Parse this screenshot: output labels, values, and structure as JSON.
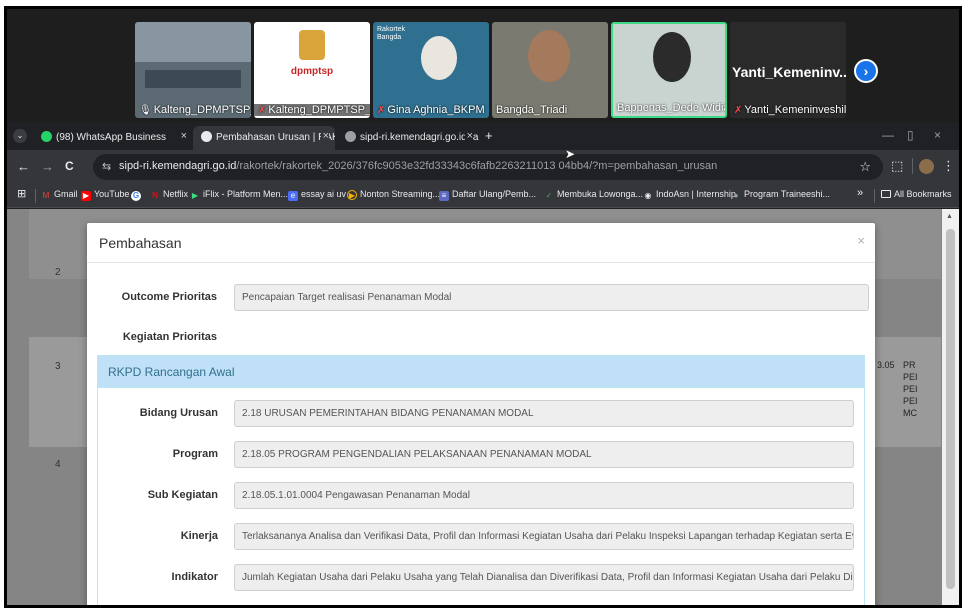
{
  "participants": [
    {
      "name": "Kalteng_DPMPTSP_Su...",
      "muted": false
    },
    {
      "name": "Kalteng_DPMPTSP_Su...",
      "muted": true,
      "logo_text": "dpmptsp"
    },
    {
      "name": "Gina Aghnia_BKPM",
      "muted": true,
      "badge": "Rakortek Bangda"
    },
    {
      "name": "Bangda_Triadi",
      "muted": false
    },
    {
      "name": "Bappenas_Dede Widia",
      "muted": false,
      "active": true
    },
    {
      "name": "Yanti_Kemeninveshil/B...",
      "muted": true,
      "big_name": "Yanti_Kemeninv..."
    }
  ],
  "tabs": [
    {
      "label": "(98) WhatsApp Business",
      "active": false
    },
    {
      "label": "Pembahasan Urusan | RAKORTE",
      "active": true
    },
    {
      "label": "sipd-ri.kemendagri.go.id/rakort",
      "active": false
    }
  ],
  "browser": {
    "url_host": "sipd-ri.kemendagri.go.id",
    "url_path": "/rakortek/rakortek_2026/376fc9053e32fd33343c6fafb2263211013 04bb4/?m=pembahasan_urusan",
    "new_tab": "+",
    "close": "×",
    "back": "←",
    "forward": "→",
    "reload": "C",
    "star": "☆"
  },
  "bookmarks": [
    {
      "label": "Gmail",
      "color": "#ea4335",
      "icon": "M"
    },
    {
      "label": "YouTube",
      "color": "#ff0000",
      "icon": "▶"
    },
    {
      "label": "",
      "color": "#ffffff",
      "icon": "G"
    },
    {
      "label": "Netflix",
      "color": "#e50914",
      "icon": "N"
    },
    {
      "label": "iFlix - Platform Men...",
      "color": "#3ddc84",
      "icon": "▶"
    },
    {
      "label": "essay ai uv",
      "color": "#4a6cf7",
      "icon": "e"
    },
    {
      "label": "Nonton Streaming...",
      "color": "#f4b400",
      "icon": "▶"
    },
    {
      "label": "Daftar Ulang/Pemb...",
      "color": "#5c6bc0",
      "icon": "≡"
    },
    {
      "label": "Membuka Lowonga...",
      "color": "#4caf50",
      "icon": "✓"
    },
    {
      "label": "IndoAsn | Internship",
      "color": "#9aa0a6",
      "icon": "◉"
    },
    {
      "label": "Program Traineeshi...",
      "color": "#607d8b",
      "icon": "●"
    }
  ],
  "bookmarks_overflow": "»",
  "all_bookmarks": "All Bookmarks",
  "page": {
    "row_numbers": [
      "2",
      "3",
      "4"
    ],
    "side_code": "3.05",
    "side_text": [
      "PR",
      "PEI",
      "PEI",
      "PEI",
      "MC"
    ]
  },
  "modal": {
    "title": "Pembahasan",
    "close": "×",
    "outcome_label": "Outcome Prioritas",
    "outcome_value": "Pencapaian Target realisasi Penanaman Modal",
    "kegiatan_label": "Kegiatan Prioritas",
    "section_title": "RKPD Rancangan Awal",
    "fields": [
      {
        "label": "Bidang Urusan",
        "value": "2.18 URUSAN PEMERINTAHAN BIDANG PENANAMAN MODAL"
      },
      {
        "label": "Program",
        "value": "2.18.05 PROGRAM PENGENDALIAN PELAKSANAAN PENANAMAN MODAL"
      },
      {
        "label": "Sub Kegiatan",
        "value": "2.18.05.1.01.0004 Pengawasan Penanaman Modal"
      },
      {
        "label": "Kinerja",
        "value": "Terlaksananya Analisa dan Verifikasi Data,  Profil dan Informasi Kegiatan Usaha dari Pelaku  Inspeksi Lapangan terhadap Kegiatan  serta Evaluasi Penilaian Ke"
      },
      {
        "label": "Indikator",
        "value": "Jumlah Kegiatan Usaha dari Pelaku Usaha yang Telah Dianalisa dan Diverifikasi Data,  Profil dan Informasi Kegiatan Usaha dari Pelaku  Dilakukan Inspeksi Lap"
      }
    ]
  }
}
